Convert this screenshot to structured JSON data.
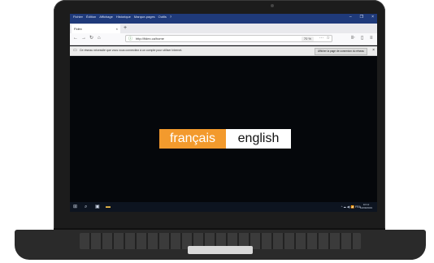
{
  "browser": {
    "menu": [
      "Fichier",
      "Édition",
      "Affichage",
      "Historique",
      "Marque-pages",
      "Outils",
      "?"
    ],
    "tab": {
      "title": "Fidex",
      "close": "×"
    },
    "new_tab": "+",
    "window_controls": [
      "–",
      "❐",
      "×"
    ],
    "url": "http://fidex.ca/home",
    "zoom": "70 %",
    "menu_dots": "···",
    "bookmark": "☆"
  },
  "notification": {
    "text": "Ce réseau nécessite que vous vous connectiez à un compte pour utiliser Internet.",
    "button": "Afficher la page de connexion du réseau",
    "close": "×"
  },
  "content": {
    "lang_fr": "français",
    "lang_en": "english"
  },
  "taskbar": {
    "tray": "^ ☁ ◀) 📶 FRA",
    "time": "10:12",
    "date": "12/09/2019"
  },
  "colors": {
    "accent_orange": "#f39a2d",
    "titlebar_blue": "#1f3a7a"
  }
}
